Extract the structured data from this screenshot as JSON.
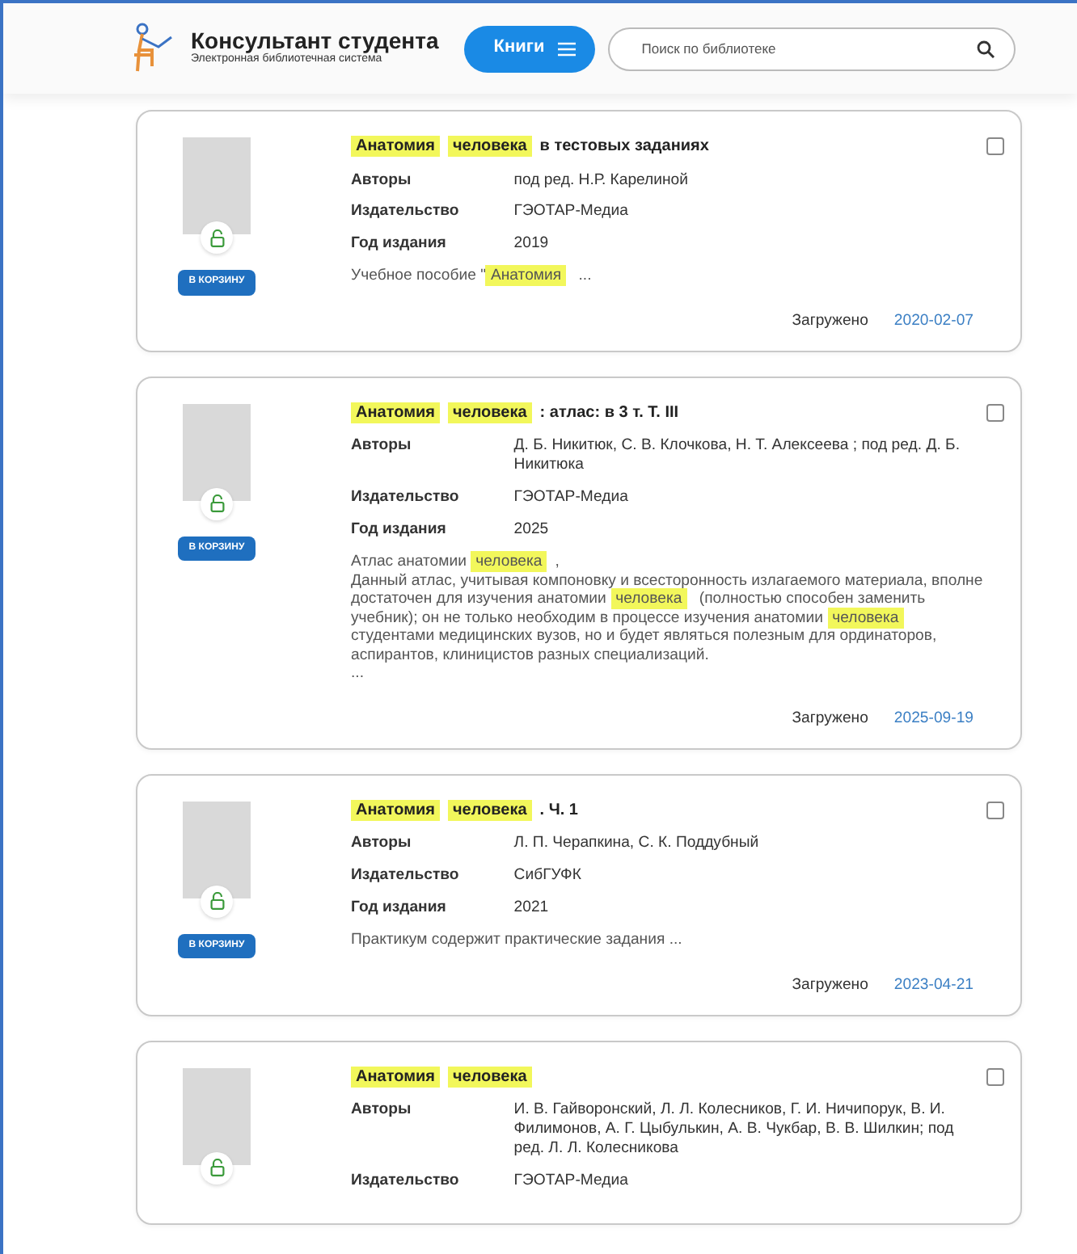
{
  "header": {
    "logo_title": "Консультант студента",
    "logo_subtitle": "Электронная библиотечная система",
    "menu_button": "Книги",
    "search": {
      "placeholder": "Поиск по библиотеке"
    }
  },
  "results": [
    {
      "checked": false,
      "cart_button": "В КОРЗИНУ",
      "title": [
        {
          "text": "Анатомия",
          "highlight": true
        },
        {
          "text": "человека",
          "highlight": true
        },
        {
          "text": "в тестовых заданиях",
          "highlight": false
        }
      ],
      "fields": [
        {
          "label": "Авторы",
          "value": "под ред. Н.Р. Карелиной"
        },
        {
          "label": "Издательство",
          "value": "ГЭОТАР-Медиа"
        },
        {
          "label": "Год издания",
          "value": "2019"
        }
      ],
      "description": [
        [
          {
            "text": "Учебное пособие \"",
            "highlight": false
          },
          {
            "text": "Анатомия",
            "highlight": true
          },
          {
            "text": " ...",
            "highlight": false
          }
        ]
      ],
      "uploaded_label": "Загружено",
      "uploaded_date": "2020-02-07"
    },
    {
      "checked": false,
      "cart_button": "В КОРЗИНУ",
      "title": [
        {
          "text": "Анатомия",
          "highlight": true
        },
        {
          "text": "человека",
          "highlight": true
        },
        {
          "text": ": атлас: в 3 т. Т. III",
          "highlight": false
        }
      ],
      "fields": [
        {
          "label": "Авторы",
          "value": "Д. Б. Никитюк, С. В. Клочкова, Н. Т. Алексеева ; под ред. Д. Б. Никитюка"
        },
        {
          "label": "Издательство",
          "value": "ГЭОТАР-Медиа"
        },
        {
          "label": "Год издания",
          "value": "2025"
        }
      ],
      "description": [
        [
          {
            "text": "Атлас анатомии ",
            "highlight": false
          },
          {
            "text": "человека",
            "highlight": true
          },
          {
            "text": ",",
            "highlight": false
          }
        ],
        [
          {
            "text": "Данный атлас, учитывая компоновку и всесторонность излагаемого материала, вполне достаточен для изучения анатомии ",
            "highlight": false
          },
          {
            "text": "человека",
            "highlight": true
          },
          {
            "text": " (полностью способен заменить учебник); он не только необходим в процессе изучения анатомии ",
            "highlight": false
          },
          {
            "text": "человека",
            "highlight": true
          },
          {
            "text": " студентами медицинских вузов, но и будет являться полезным для ординаторов, аспирантов, клиницистов разных специализаций.",
            "highlight": false
          }
        ],
        [
          {
            "text": "...",
            "highlight": false
          }
        ]
      ],
      "uploaded_label": "Загружено",
      "uploaded_date": "2025-09-19"
    },
    {
      "checked": false,
      "cart_button": "В КОРЗИНУ",
      "title": [
        {
          "text": "Анатомия",
          "highlight": true
        },
        {
          "text": "человека",
          "highlight": true
        },
        {
          "text": ". Ч. 1",
          "highlight": false
        }
      ],
      "fields": [
        {
          "label": "Авторы",
          "value": "Л. П. Черапкина, С. К. Поддубный"
        },
        {
          "label": "Издательство",
          "value": "СибГУФК"
        },
        {
          "label": "Год издания",
          "value": "2021"
        }
      ],
      "description": [
        [
          {
            "text": "Практикум содержит практические задания  ...",
            "highlight": false
          }
        ]
      ],
      "uploaded_label": "Загружено",
      "uploaded_date": "2023-04-21"
    },
    {
      "checked": false,
      "title": [
        {
          "text": "Анатомия",
          "highlight": true
        },
        {
          "text": "человека",
          "highlight": true
        }
      ],
      "fields": [
        {
          "label": "Авторы",
          "value": "И. В. Гайворонский, Л. Л. Колесников, Г. И. Ничипорук, В. И. Филимонов, А. Г. Цыбулькин, А. В. Чукбар, В. В. Шилкин; под ред. Л. Л. Колесникова"
        },
        {
          "label": "Издательство",
          "value": "ГЭОТАР-Медиа"
        }
      ]
    }
  ]
}
